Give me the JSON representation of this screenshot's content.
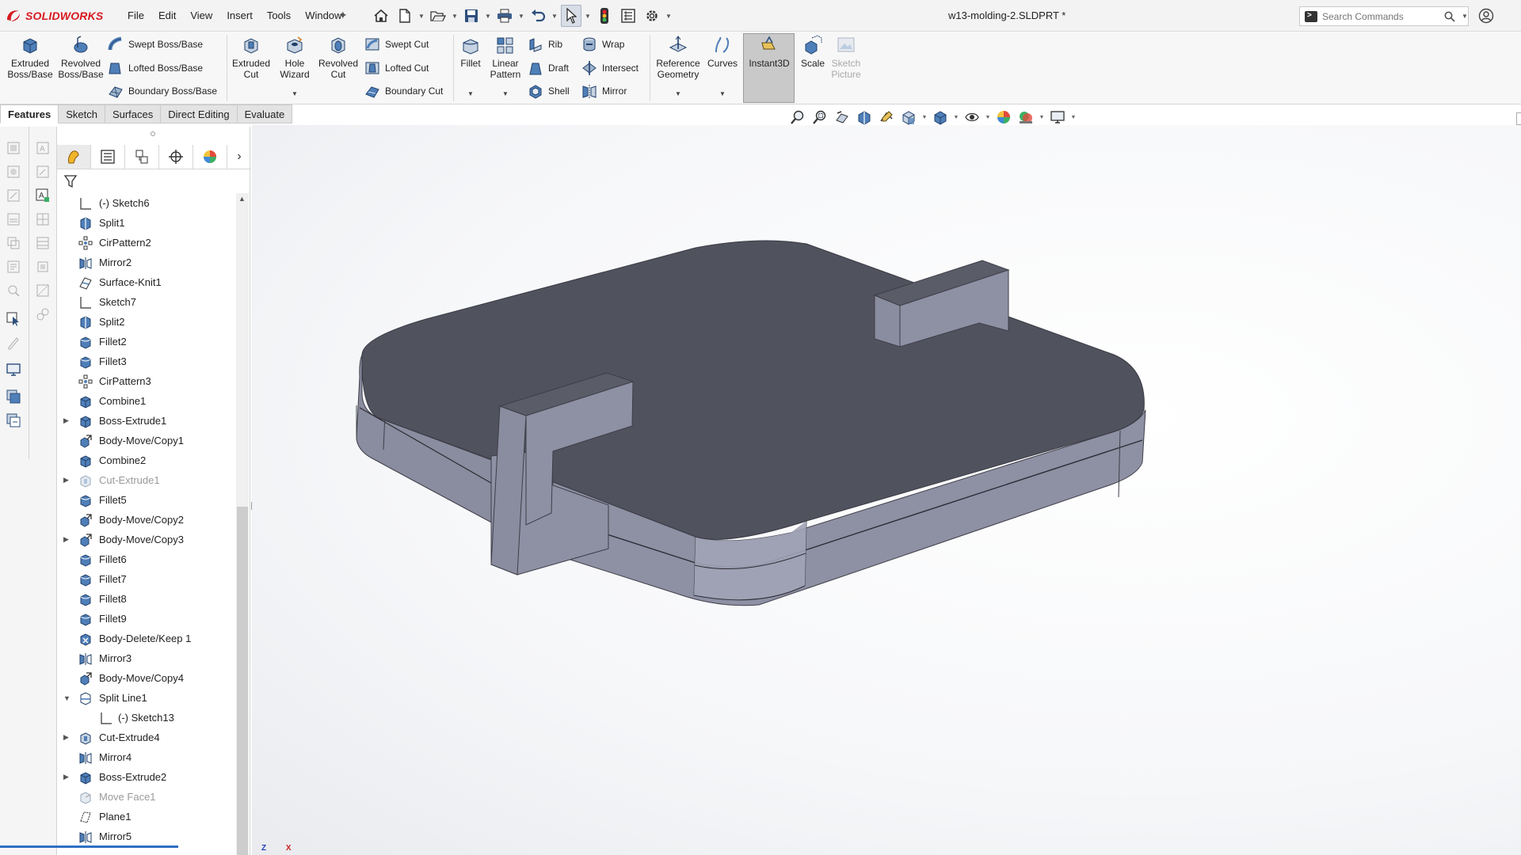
{
  "app": {
    "brand": "SOLIDWORKS",
    "document_title": "w13-molding-2.SLDPRT *",
    "menu": [
      "File",
      "Edit",
      "View",
      "Insert",
      "Tools",
      "Window"
    ],
    "search_placeholder": "Search Commands"
  },
  "ribbon": {
    "extruded_boss": "Extruded\nBoss/Base",
    "revolved_boss": "Revolved\nBoss/Base",
    "swept_boss": "Swept Boss/Base",
    "lofted_boss": "Lofted Boss/Base",
    "boundary_boss": "Boundary Boss/Base",
    "extruded_cut": "Extruded\nCut",
    "hole_wizard": "Hole\nWizard",
    "revolved_cut": "Revolved\nCut",
    "swept_cut": "Swept Cut",
    "lofted_cut": "Lofted Cut",
    "boundary_cut": "Boundary Cut",
    "fillet": "Fillet",
    "linear_pattern": "Linear\nPattern",
    "rib": "Rib",
    "draft": "Draft",
    "shell": "Shell",
    "wrap": "Wrap",
    "intersect": "Intersect",
    "mirror": "Mirror",
    "reference_geometry": "Reference\nGeometry",
    "curves": "Curves",
    "instant3d": "Instant3D",
    "scale": "Scale",
    "sketch_picture": "Sketch\nPicture"
  },
  "tabs": [
    "Features",
    "Sketch",
    "Surfaces",
    "Direct Editing",
    "Evaluate"
  ],
  "active_tab": "Features",
  "tree": [
    {
      "label": "(-) Sketch6",
      "icon": "sketch-icon",
      "expandable": false
    },
    {
      "label": "Split1",
      "icon": "split-icon",
      "expandable": false
    },
    {
      "label": "CirPattern2",
      "icon": "circular-pattern-icon",
      "expandable": false
    },
    {
      "label": "Mirror2",
      "icon": "mirror-icon",
      "expandable": false
    },
    {
      "label": "Surface-Knit1",
      "icon": "surface-knit-icon",
      "expandable": false
    },
    {
      "label": "Sketch7",
      "icon": "sketch-icon",
      "expandable": false
    },
    {
      "label": "Split2",
      "icon": "split-icon",
      "expandable": false
    },
    {
      "label": "Fillet2",
      "icon": "fillet-icon",
      "expandable": false
    },
    {
      "label": "Fillet3",
      "icon": "fillet-icon",
      "expandable": false
    },
    {
      "label": "CirPattern3",
      "icon": "circular-pattern-icon",
      "expandable": false
    },
    {
      "label": "Combine1",
      "icon": "combine-icon",
      "expandable": false
    },
    {
      "label": "Boss-Extrude1",
      "icon": "boss-extrude-icon",
      "expandable": true
    },
    {
      "label": "Body-Move/Copy1",
      "icon": "move-copy-icon",
      "expandable": false
    },
    {
      "label": "Combine2",
      "icon": "combine-icon",
      "expandable": false
    },
    {
      "label": "Cut-Extrude1",
      "icon": "cut-extrude-icon",
      "expandable": true,
      "suppressed": true
    },
    {
      "label": "Fillet5",
      "icon": "fillet-icon",
      "expandable": false
    },
    {
      "label": "Body-Move/Copy2",
      "icon": "move-copy-icon",
      "expandable": false
    },
    {
      "label": "Body-Move/Copy3",
      "icon": "move-copy-icon",
      "expandable": true
    },
    {
      "label": "Fillet6",
      "icon": "fillet-icon",
      "expandable": false
    },
    {
      "label": "Fillet7",
      "icon": "fillet-icon",
      "expandable": false
    },
    {
      "label": "Fillet8",
      "icon": "fillet-icon",
      "expandable": false
    },
    {
      "label": "Fillet9",
      "icon": "fillet-icon",
      "expandable": false
    },
    {
      "label": "Body-Delete/Keep 1",
      "icon": "body-delete-icon",
      "expandable": false
    },
    {
      "label": "Mirror3",
      "icon": "mirror-icon",
      "expandable": false
    },
    {
      "label": "Body-Move/Copy4",
      "icon": "move-copy-icon",
      "expandable": false
    },
    {
      "label": "Split Line1",
      "icon": "split-line-icon",
      "expandable": true,
      "expanded": true
    },
    {
      "label": "(-) Sketch13",
      "icon": "sketch-icon",
      "expandable": false,
      "child": true
    },
    {
      "label": "Cut-Extrude4",
      "icon": "cut-extrude-icon",
      "expandable": true
    },
    {
      "label": "Mirror4",
      "icon": "mirror-icon",
      "expandable": false
    },
    {
      "label": "Boss-Extrude2",
      "icon": "boss-extrude-icon",
      "expandable": true
    },
    {
      "label": "Move Face1",
      "icon": "move-face-icon",
      "expandable": false,
      "suppressed": true
    },
    {
      "label": "Plane1",
      "icon": "plane-icon",
      "expandable": false
    },
    {
      "label": "Mirror5",
      "icon": "mirror-icon",
      "expandable": false
    }
  ],
  "triad": {
    "z": "Z",
    "x": "X"
  },
  "colors": {
    "brand_red": "#d71920",
    "model_top": "#50525e",
    "model_side": "#8a8ca0",
    "selection_blue": "#2f6fc4"
  }
}
